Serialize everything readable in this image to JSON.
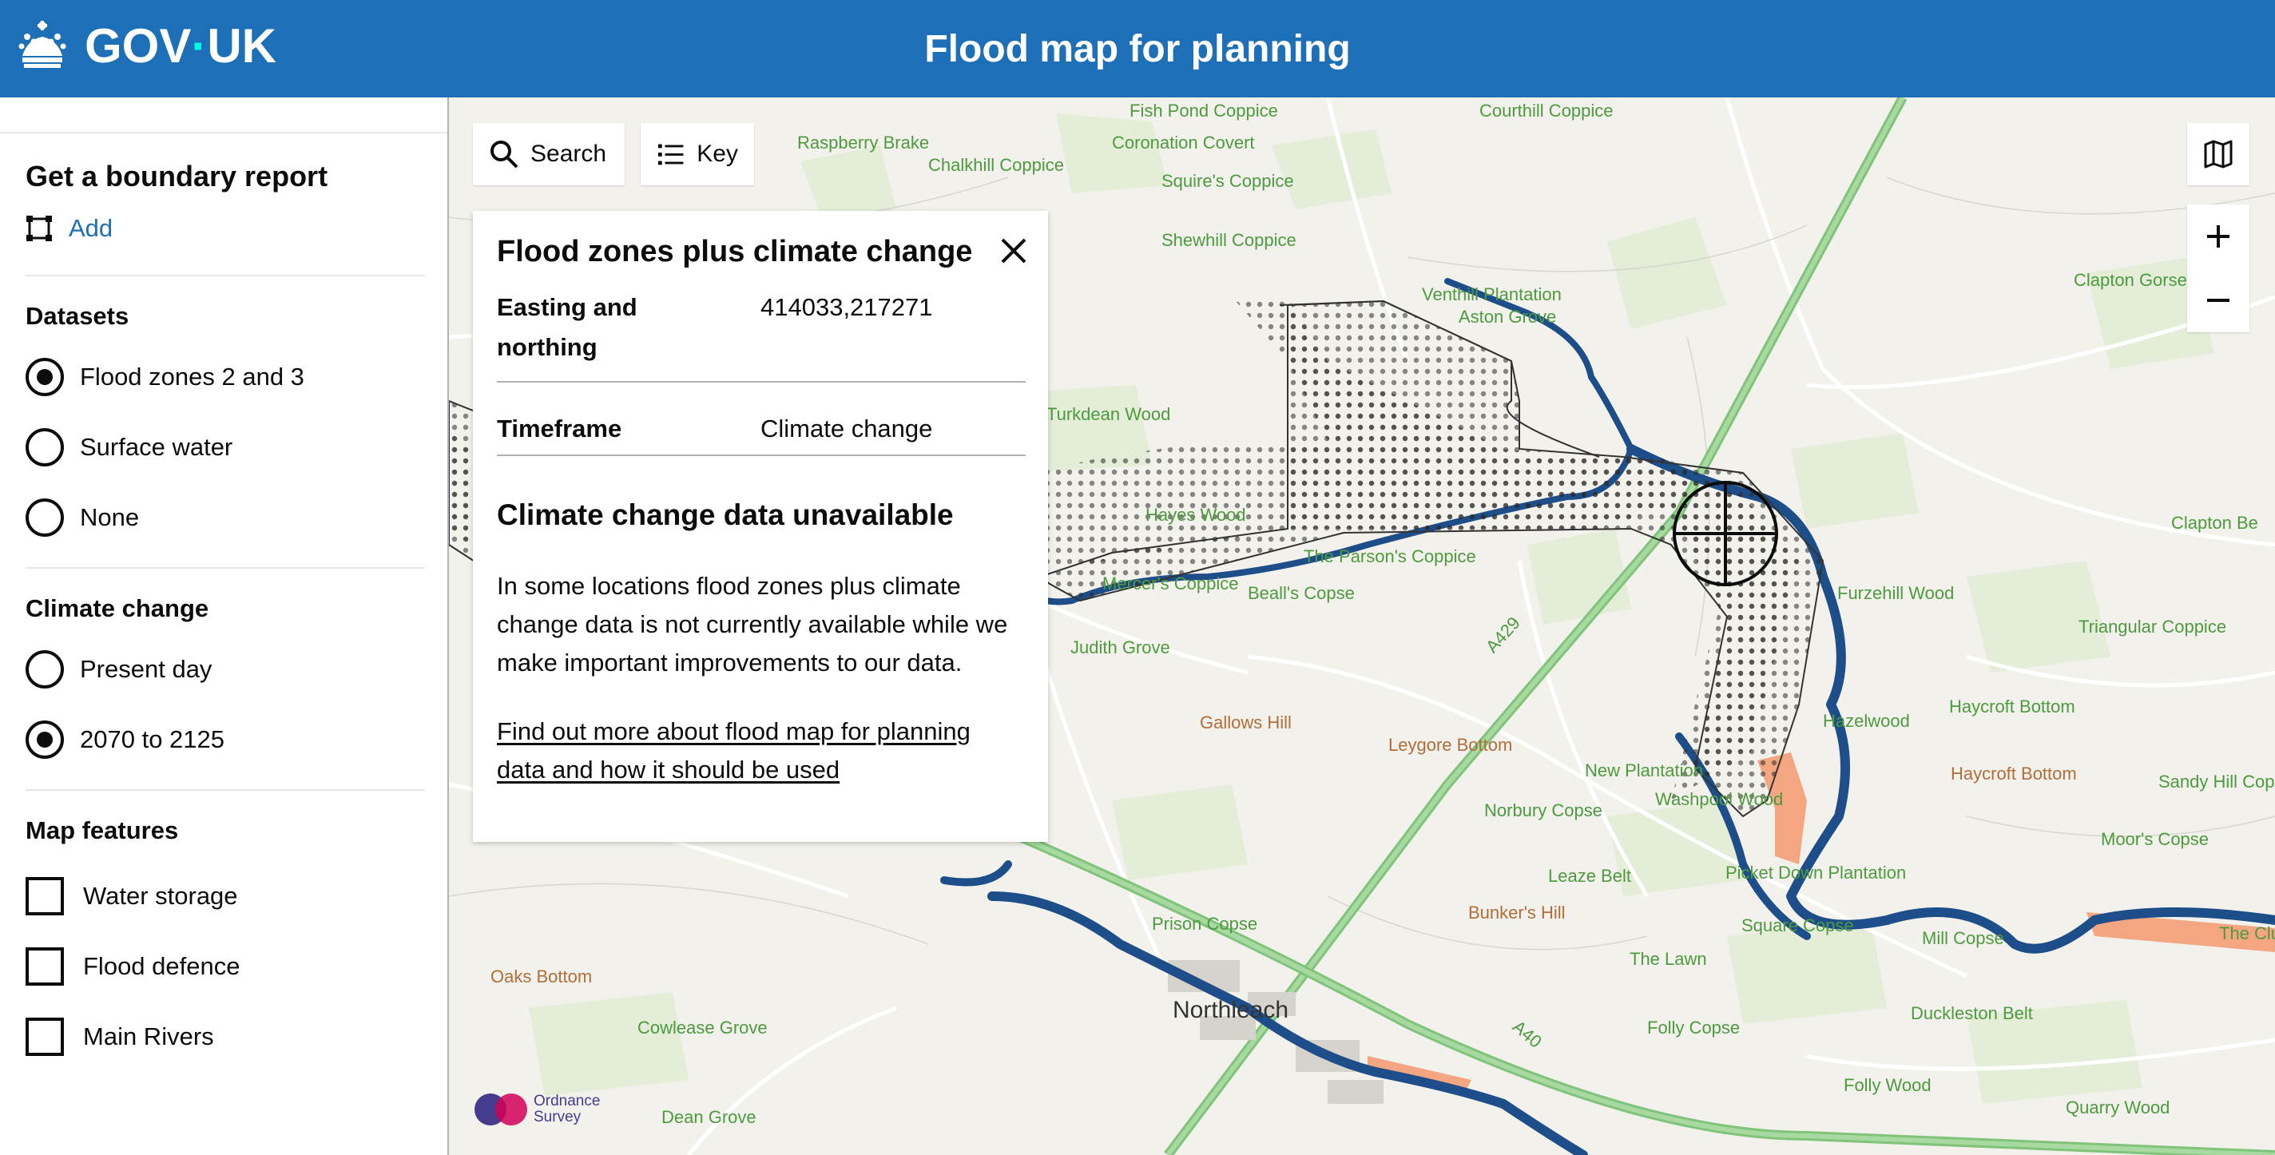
{
  "header": {
    "brand": "GOV",
    "brand_suffix": "UK",
    "title": "Flood map for planning",
    "colors": {
      "background": "#1d70b8",
      "text": "#ffffff"
    }
  },
  "sidebar": {
    "boundary": {
      "heading": "Get a boundary report",
      "add_label": "Add"
    },
    "datasets": {
      "heading": "Datasets",
      "options": [
        {
          "label": "Flood zones 2 and 3",
          "selected": true
        },
        {
          "label": "Surface water",
          "selected": false
        },
        {
          "label": "None",
          "selected": false
        }
      ]
    },
    "climate": {
      "heading": "Climate change",
      "options": [
        {
          "label": "Present day",
          "selected": false
        },
        {
          "label": "2070 to 2125",
          "selected": true
        }
      ]
    },
    "features": {
      "heading": "Map features",
      "options": [
        {
          "label": "Water storage",
          "checked": false
        },
        {
          "label": "Flood defence",
          "checked": false
        },
        {
          "label": "Main Rivers",
          "checked": false
        }
      ]
    }
  },
  "map": {
    "controls": {
      "search": "Search",
      "key": "Key"
    },
    "labels": [
      {
        "text": "Fish Pond Coppice",
        "cls": "green"
      },
      {
        "text": "Courthill Coppice",
        "cls": "green"
      },
      {
        "text": "Raspberry Brake",
        "cls": "green"
      },
      {
        "text": "Coronation Covert",
        "cls": "green"
      },
      {
        "text": "Chalkhill Coppice",
        "cls": "green"
      },
      {
        "text": "Squire's Coppice",
        "cls": "green"
      },
      {
        "text": "Shewhill Coppice",
        "cls": "green"
      },
      {
        "text": "Clapton Gorse",
        "cls": "green"
      },
      {
        "text": "Venthill Plantation",
        "cls": "green"
      },
      {
        "text": "Aston Grove",
        "cls": "green"
      },
      {
        "text": "Turkdean Wood",
        "cls": "green"
      },
      {
        "text": "Hayes Wood",
        "cls": "green"
      },
      {
        "text": "The Parson's Coppice",
        "cls": "green"
      },
      {
        "text": "Beall's Copse",
        "cls": "green"
      },
      {
        "text": "Mercer's Coppice",
        "cls": "green"
      },
      {
        "text": "Judith Grove",
        "cls": "green"
      },
      {
        "text": "Gallows Hill",
        "cls": "brown"
      },
      {
        "text": "Leygore Bottom",
        "cls": "brown"
      },
      {
        "text": "Furzehill Wood",
        "cls": "green"
      },
      {
        "text": "Clapton Be",
        "cls": "green"
      },
      {
        "text": "Triangular Coppice",
        "cls": "green"
      },
      {
        "text": "Haycroft Bottom",
        "cls": "green"
      },
      {
        "text": "Haycroft Bottom",
        "cls": "brown"
      },
      {
        "text": "Sandy Hill Cops",
        "cls": "green"
      },
      {
        "text": "Moor's Copse",
        "cls": "green"
      },
      {
        "text": "New Plantation",
        "cls": "green"
      },
      {
        "text": "Washpool Wood",
        "cls": "green"
      },
      {
        "text": "Norbury Copse",
        "cls": "green"
      },
      {
        "text": "Hazelwood",
        "cls": "green"
      },
      {
        "text": "Leaze Belt",
        "cls": "green"
      },
      {
        "text": "Picket Down Plantation",
        "cls": "green"
      },
      {
        "text": "Bunker's Hill",
        "cls": "brown"
      },
      {
        "text": "Square Copse",
        "cls": "green"
      },
      {
        "text": "Mill Copse",
        "cls": "green"
      },
      {
        "text": "The Clu",
        "cls": "green"
      },
      {
        "text": "Prison Copse",
        "cls": "green"
      },
      {
        "text": "The Lawn",
        "cls": "green"
      },
      {
        "text": "Oaks Bottom",
        "cls": "brown"
      },
      {
        "text": "Northleach",
        "cls": "dark"
      },
      {
        "text": "Duckleston Belt",
        "cls": "green"
      },
      {
        "text": "Cowlease Grove",
        "cls": "green"
      },
      {
        "text": "Folly Copse",
        "cls": "green"
      },
      {
        "text": "Folly Wood",
        "cls": "green"
      },
      {
        "text": "Dean Grove",
        "cls": "green"
      },
      {
        "text": "Quarry Wood",
        "cls": "green"
      },
      {
        "text": "A429",
        "cls": "green"
      },
      {
        "text": "A40",
        "cls": "green"
      }
    ],
    "attribution": [
      "Ordnance",
      "Survey"
    ]
  },
  "info_panel": {
    "title": "Flood zones plus climate change",
    "rows": [
      {
        "key": "Easting and northing",
        "value": "414033,217271"
      },
      {
        "key": "Timeframe",
        "value": "Climate change"
      }
    ],
    "heading": "Climate change data unavailable",
    "body": "In some locations flood zones plus climate change data is not currently available while we make important improvements to our data.",
    "link": "Find out more about flood map for planning data and how it should be used"
  }
}
